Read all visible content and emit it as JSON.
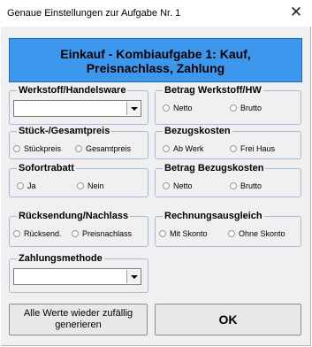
{
  "window": {
    "title": "Genaue Einstellungen zur Aufgabe Nr. 1",
    "close_glyph": "✕"
  },
  "banner": {
    "line1": "Einkauf - Kombiaufgabe 1: Kauf,",
    "line2": "Preisnachlass, Zahlung",
    "color": "#3d97ec"
  },
  "groups": {
    "werkstoff": {
      "title": "Werkstoff/Handelsware",
      "value": ""
    },
    "betrag_werkstoff": {
      "title": "Betrag Werkstoff/HW",
      "options": [
        "Netto",
        "Brutto"
      ]
    },
    "stueckpreis": {
      "title": "Stück-/Gesamtpreis",
      "options": [
        "Stückpreis",
        "Gesamtpreis"
      ]
    },
    "bezugskosten": {
      "title": "Bezugskosten",
      "options": [
        "Ab Werk",
        "Frei Haus"
      ]
    },
    "sofortrabatt": {
      "title": "Sofortrabatt",
      "options": [
        "Ja",
        "Nein"
      ]
    },
    "betrag_bezugskosten": {
      "title": "Betrag Bezugskosten",
      "options": [
        "Netto",
        "Brutto"
      ]
    },
    "ruecksendung": {
      "title": "Rücksendung/Nachlass",
      "options": [
        "Rücksend.",
        "Preisnachlass"
      ]
    },
    "rechnungsausgleich": {
      "title": "Rechnungsausgleich",
      "options": [
        "Mit Skonto",
        "Ohne Skonto"
      ]
    },
    "zahlungsmethode": {
      "title": "Zahlungsmethode",
      "value": ""
    }
  },
  "buttons": {
    "random_line1": "Alle Werte wieder zufällig",
    "random_line2": "generieren",
    "ok": "OK"
  },
  "icons": {
    "close": "close-icon",
    "dropdown": "chevron-down-icon"
  }
}
